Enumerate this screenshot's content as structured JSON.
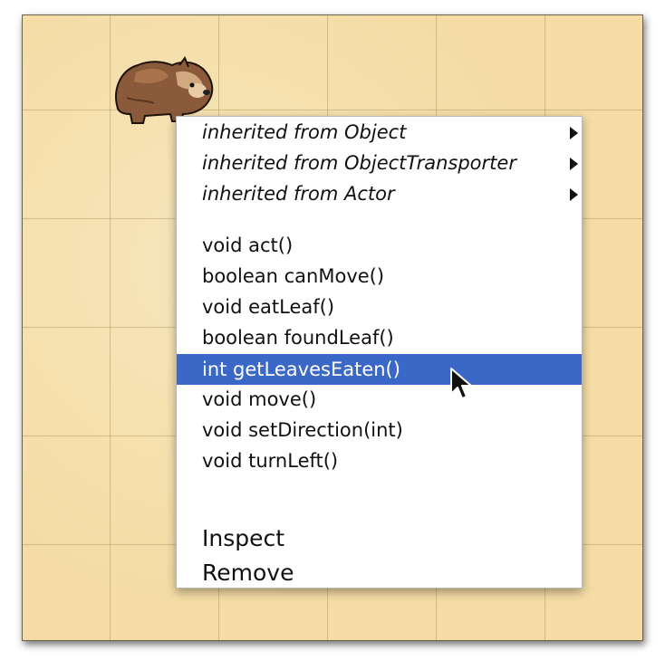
{
  "menu": {
    "inherited": [
      {
        "label": "inherited from Object"
      },
      {
        "label": "inherited from ObjectTransporter"
      },
      {
        "label": "inherited from Actor"
      }
    ],
    "methods": [
      {
        "label": "void act()"
      },
      {
        "label": "boolean canMove()"
      },
      {
        "label": "void eatLeaf()"
      },
      {
        "label": "boolean foundLeaf()"
      },
      {
        "label": "int getLeavesEaten()"
      },
      {
        "label": "void move()"
      },
      {
        "label": "void setDirection(int)"
      },
      {
        "label": "void turnLeft()"
      }
    ],
    "selected_item": "int getLeavesEaten()",
    "actions": [
      {
        "label": "Inspect"
      },
      {
        "label": "Remove"
      }
    ]
  },
  "colors": {
    "world_background": "#f4dca4",
    "selection": "#3b68c6"
  },
  "icons": {
    "actor": "wombat-icon",
    "submenu": "submenu-arrow-icon",
    "pointer": "mouse-cursor-icon"
  }
}
